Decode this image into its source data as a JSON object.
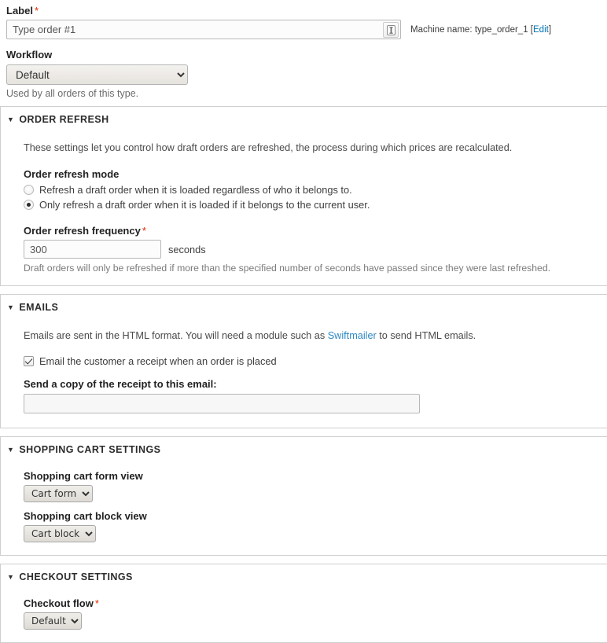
{
  "form": {
    "label_field": {
      "label": "Label",
      "required_marker": "*",
      "value": "Type order #1",
      "placeholder": "",
      "spin_icon": "machine-name-toggle-icon"
    },
    "machine_name": {
      "prefix": "Machine name: ",
      "value": "type_order_1",
      "edit_open": " [",
      "edit_link": "Edit",
      "edit_close": "]"
    },
    "workflow": {
      "label": "Workflow",
      "selected": "Default",
      "options": [
        "Default"
      ],
      "description": "Used by all orders of this type."
    }
  },
  "sections": {
    "order_refresh": {
      "legend": "ORDER REFRESH",
      "triangle": "▼",
      "intro": "These settings let you control how draft orders are refreshed, the process during which prices are recalculated.",
      "mode_label": "Order refresh mode",
      "modes": [
        {
          "label": "Refresh a draft order when it is loaded regardless of who it belongs to.",
          "checked": false
        },
        {
          "label": "Only refresh a draft order when it is loaded if it belongs to the current user.",
          "checked": true
        }
      ],
      "frequency_label": "Order refresh frequency",
      "frequency_required": "*",
      "frequency_value": "300",
      "frequency_unit": "seconds",
      "frequency_description": "Draft orders will only be refreshed if more than the specified number of seconds have passed since they were last refreshed."
    },
    "emails": {
      "legend": "EMAILS",
      "triangle": "▼",
      "intro_before": "Emails are sent in the HTML format. You will need a module such as ",
      "intro_link": "Swiftmailer",
      "intro_after": " to send HTML emails.",
      "receipt_checkbox": {
        "label": "Email the customer a receipt when an order is placed",
        "checked": true
      },
      "bcc_label": "Send a copy of the receipt to this email:",
      "bcc_value": "",
      "bcc_placeholder": ""
    },
    "shopping_cart": {
      "legend": "SHOPPING CART SETTINGS",
      "triangle": "▼",
      "form_view_label": "Shopping cart form view",
      "form_view_selected": "Cart form",
      "form_view_options": [
        "Cart form"
      ],
      "block_view_label": "Shopping cart block view",
      "block_view_selected": "Cart block",
      "block_view_options": [
        "Cart block"
      ]
    },
    "checkout": {
      "legend": "CHECKOUT SETTINGS",
      "triangle": "▼",
      "flow_label": "Checkout flow",
      "flow_required": "*",
      "flow_selected": "Default",
      "flow_options": [
        "Default"
      ]
    }
  },
  "colors": {
    "required": "#e32700",
    "link": "#2e87c4",
    "machine_link": "#0071b3",
    "border": "#cfcfcf"
  }
}
